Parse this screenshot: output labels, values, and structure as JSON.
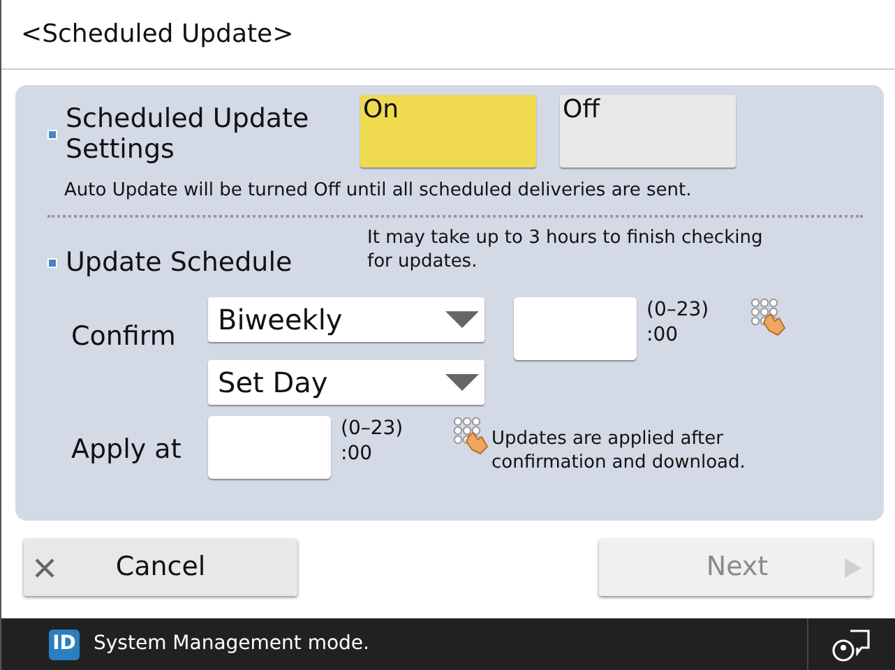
{
  "title": "<Scheduled Update>",
  "settings": {
    "label": "Scheduled Update Settings",
    "options": [
      {
        "label": "On",
        "selected": true
      },
      {
        "label": "Off",
        "selected": false
      }
    ],
    "note": "Auto Update will be turned Off until all scheduled deliveries are sent."
  },
  "schedule": {
    "label": "Update Schedule",
    "note": "It may take up to 3 hours to finish checking for updates.",
    "confirm": {
      "label": "Confirm",
      "frequency": "Biweekly",
      "day": "Set Day",
      "range": "(0–23)",
      "suffix": ":00"
    },
    "apply": {
      "label": "Apply at",
      "range": "(0–23)",
      "suffix": ":00",
      "note": "Updates are applied after confirmation and download."
    }
  },
  "buttons": [
    {
      "label": "Cancel",
      "kind": "cancel",
      "disabled": false
    },
    {
      "label": "Next",
      "kind": "next",
      "disabled": true
    }
  ],
  "status_bar": {
    "badge": "ID",
    "text": "System Management mode."
  }
}
